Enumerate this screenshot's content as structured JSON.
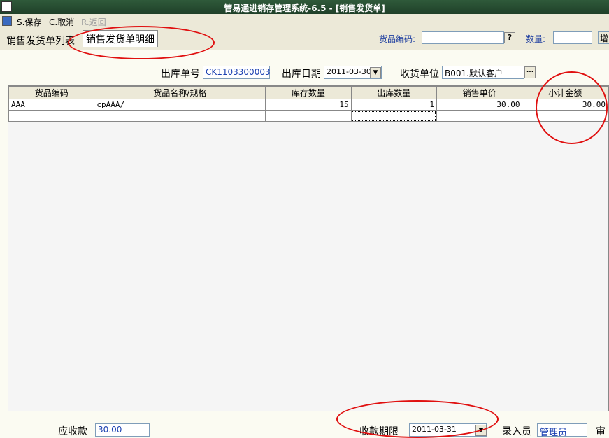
{
  "window": {
    "title": "管易通进销存管理系统-6.5 - [销售发货单]"
  },
  "toolbar": {
    "save": "S.保存",
    "cancel": "C.取消",
    "back": "R.返回"
  },
  "tabs": {
    "list": "销售发货单列表",
    "detail": "销售发货单明细"
  },
  "search": {
    "code_label": "货品编码:",
    "code_btn": "?",
    "qty_label": "数量:",
    "cut_btn": "增"
  },
  "header": {
    "order_no_label": "出库单号",
    "order_no": "CK1103300003",
    "date_label": "出库日期",
    "date": "2011-03-30",
    "customer_label": "收货单位",
    "customer": "B001.默认客户",
    "customer_btn": "..."
  },
  "table": {
    "columns": [
      "货品编码",
      "货品名称/规格",
      "库存数量",
      "出库数量",
      "销售单价",
      "小计金额"
    ],
    "rows": [
      [
        "AAA",
        "cpAAA/",
        "15",
        "1",
        "30.00",
        "30.00"
      ],
      [
        "",
        "",
        "",
        "",
        "",
        ""
      ]
    ]
  },
  "footer": {
    "receivable_label": "应收款",
    "receivable": "30.00",
    "due_label": "收款期限",
    "due_date": "2011-03-31",
    "entered_label": "录入员",
    "entered_by": "管理员",
    "audit_label": "审"
  }
}
